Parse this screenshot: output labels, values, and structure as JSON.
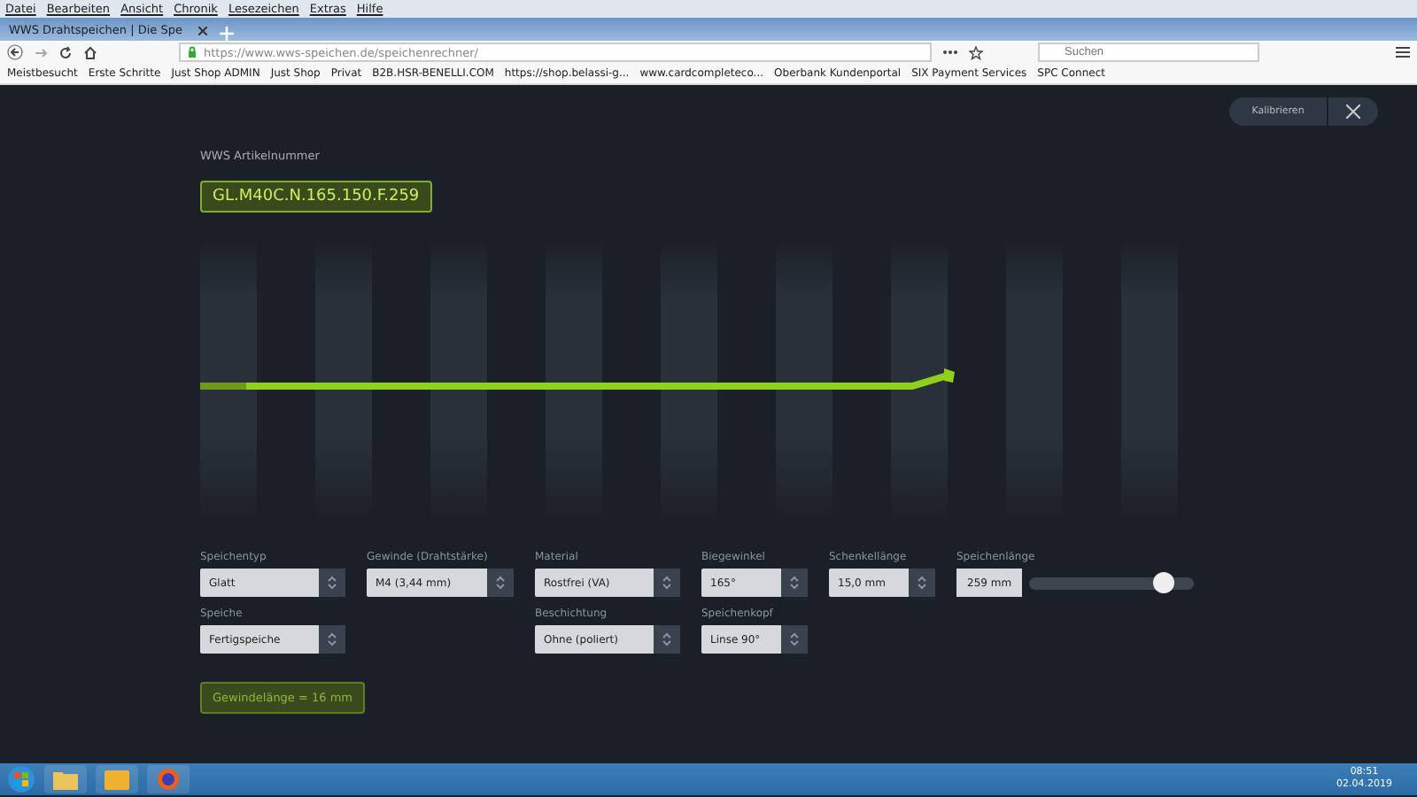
{
  "browser": {
    "menu": [
      "Datei",
      "Bearbeiten",
      "Ansicht",
      "Chronik",
      "Lesezeichen",
      "Extras",
      "Hilfe"
    ],
    "tab_title": "WWS Drahtspeichen | Die Spe",
    "url_host": "https://www.wws-speichen.de",
    "url_path": "/speichenrechner/",
    "search": {
      "placeholder": "Suchen"
    },
    "bookmarks": [
      "Meistbesucht",
      "Erste Schritte",
      "Just Shop ADMIN",
      "Just Shop",
      "Privat",
      "B2B.HSR-BENELLI.COM",
      "https://shop.belassi-g...",
      "www.cardcompleteco...",
      "Oberbank Kundenportal",
      "SIX Payment Services",
      "SPC Connect"
    ]
  },
  "page": {
    "calibrate_button": "Kalibrieren",
    "article_label": "WWS Artikelnummer",
    "article_number": "GL.M40C.N.165.150.F.259",
    "form_rows": [
      [
        {
          "kind": "select",
          "label": "Speichentyp",
          "value": "Glatt"
        },
        {
          "kind": "select",
          "label": "Gewinde (Drahtstärke)",
          "value": "M4 (3,44 mm)"
        },
        {
          "kind": "select",
          "label": "Material",
          "value": "Rostfrei (VA)"
        },
        {
          "kind": "select",
          "label": "Biegewinkel",
          "value": "165°"
        },
        {
          "kind": "select",
          "label": "Schenkellänge",
          "value": "15,0 mm"
        },
        {
          "kind": "slider",
          "label": "Speichenlänge",
          "value": "259 mm",
          "level": 0.82
        }
      ],
      [
        {
          "kind": "select",
          "label": "Speiche",
          "value": "Fertigspeiche"
        },
        {
          "kind": "select",
          "label": "Beschichtung",
          "value": "Ohne (poliert)"
        },
        {
          "kind": "select",
          "label": "Speichenkopf",
          "value": "Linse 90°"
        }
      ]
    ],
    "thread_length": "Gewindelänge = 16 mm"
  },
  "taskbar": {
    "time": "08:51",
    "date": "02.04.2019"
  }
}
